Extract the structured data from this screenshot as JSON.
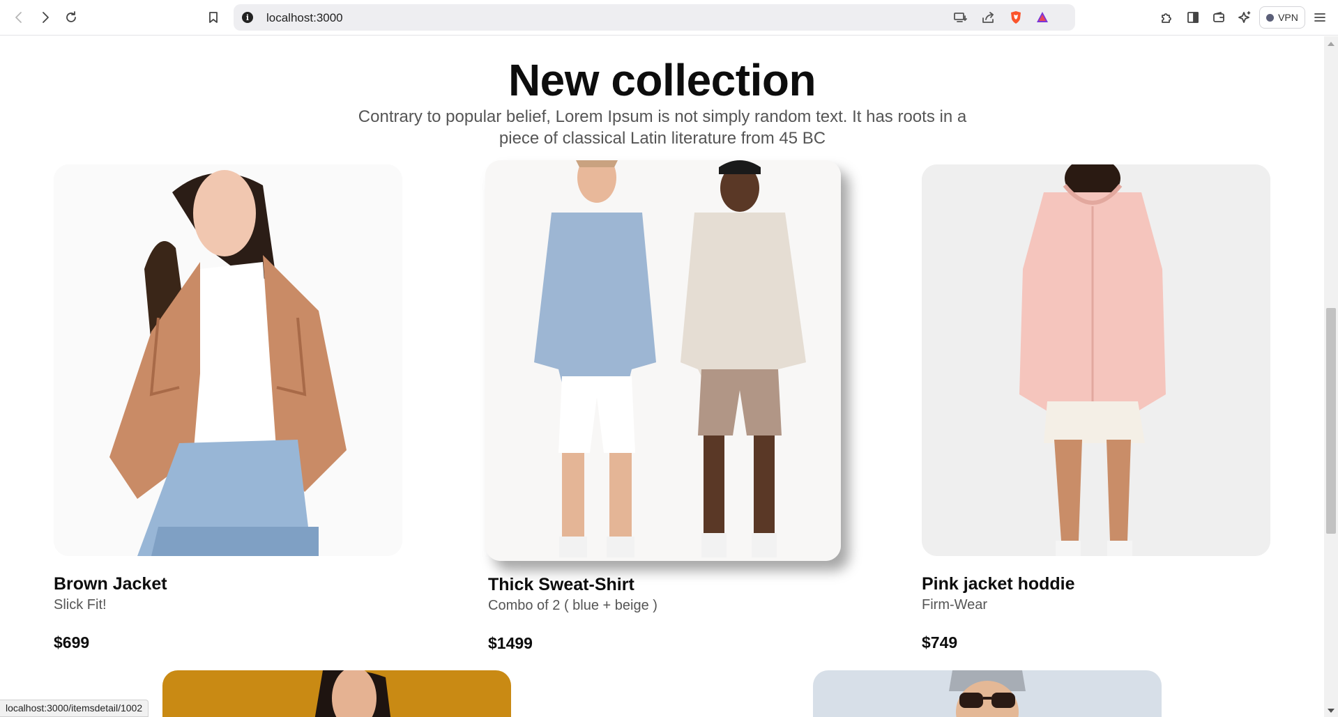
{
  "browser": {
    "url": "localhost:3000",
    "vpn_label": "VPN",
    "status_url": "localhost:3000/itemsdetail/1002"
  },
  "page": {
    "title": "New collection",
    "subtitle": "Contrary to popular belief, Lorem Ipsum is not simply random text. It has roots in a piece of classical Latin literature from 45 BC"
  },
  "products": [
    {
      "name": "Brown Jacket",
      "desc": "Slick Fit!",
      "price": "$699"
    },
    {
      "name": "Thick Sweat-Shirt",
      "desc": "Combo of 2 ( blue + beige )",
      "price": "$1499"
    },
    {
      "name": "Pink jacket hoddie",
      "desc": "Firm-Wear",
      "price": "$749"
    }
  ],
  "colors": {
    "accent_brave": "#fb542b",
    "tile1_bg": "#c98a14",
    "tile2_bg": "#d7dfe8"
  }
}
